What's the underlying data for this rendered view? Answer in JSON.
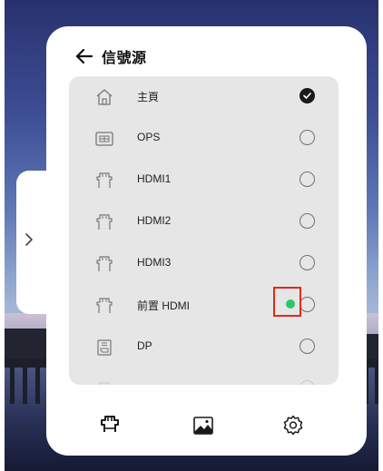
{
  "header": {
    "title": "信號源"
  },
  "sources": [
    {
      "label": "主頁",
      "icon": "home-icon",
      "state": "selected"
    },
    {
      "label": "OPS",
      "icon": "ops-module-icon",
      "state": "unselected"
    },
    {
      "label": "HDMI1",
      "icon": "hdmi-port-icon",
      "state": "unselected"
    },
    {
      "label": "HDMI2",
      "icon": "hdmi-port-icon",
      "state": "unselected"
    },
    {
      "label": "HDMI3",
      "icon": "hdmi-port-icon",
      "state": "unselected"
    },
    {
      "label": "前置 HDMI",
      "icon": "hdmi-port-icon",
      "state": "unselected",
      "signal": "active"
    },
    {
      "label": "DP",
      "icon": "displayport-icon",
      "state": "unselected"
    },
    {
      "label": "",
      "icon": "port-icon",
      "state": "partially-visible"
    }
  ],
  "bottom_bar": {
    "items": [
      "input-source-icon",
      "image-icon",
      "settings-gear-icon"
    ]
  },
  "colors": {
    "panel": "#ffffff",
    "list_background": "#e6e6e6",
    "signal_dot": "#2ec66b",
    "highlight_border": "#e0281e"
  }
}
